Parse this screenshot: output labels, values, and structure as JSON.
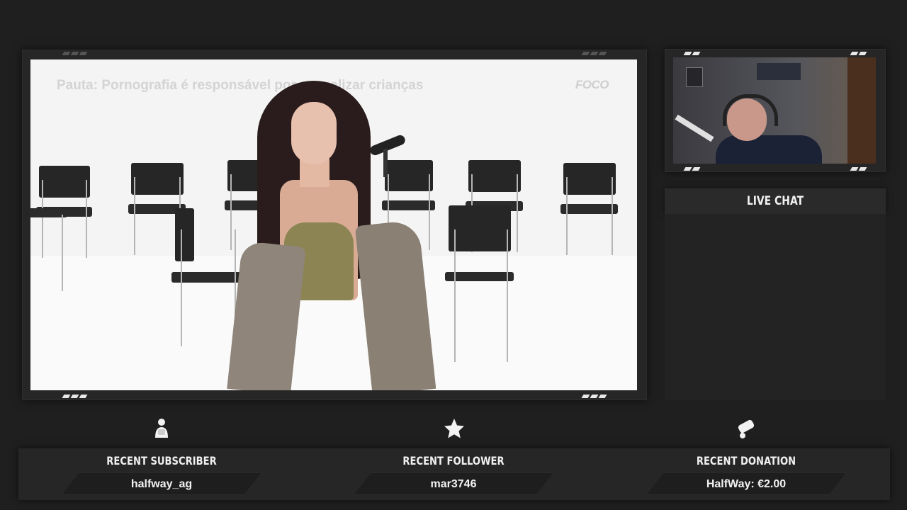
{
  "stream_video": {
    "show_title": "Pauta: Pornografia é responsável por sexualizar crianças",
    "show_logo": "FOCO"
  },
  "chat": {
    "title": "LIVE CHAT"
  },
  "stats": [
    {
      "label": "RECENT SUBSCRIBER",
      "value": "halfway_ag",
      "icon": "subscriber-icon"
    },
    {
      "label": "RECENT FOLLOWER",
      "value": "mar3746",
      "icon": "star-icon"
    },
    {
      "label": "RECENT DONATION",
      "value": "HalfWay: €2.00",
      "icon": "donation-icon"
    }
  ]
}
